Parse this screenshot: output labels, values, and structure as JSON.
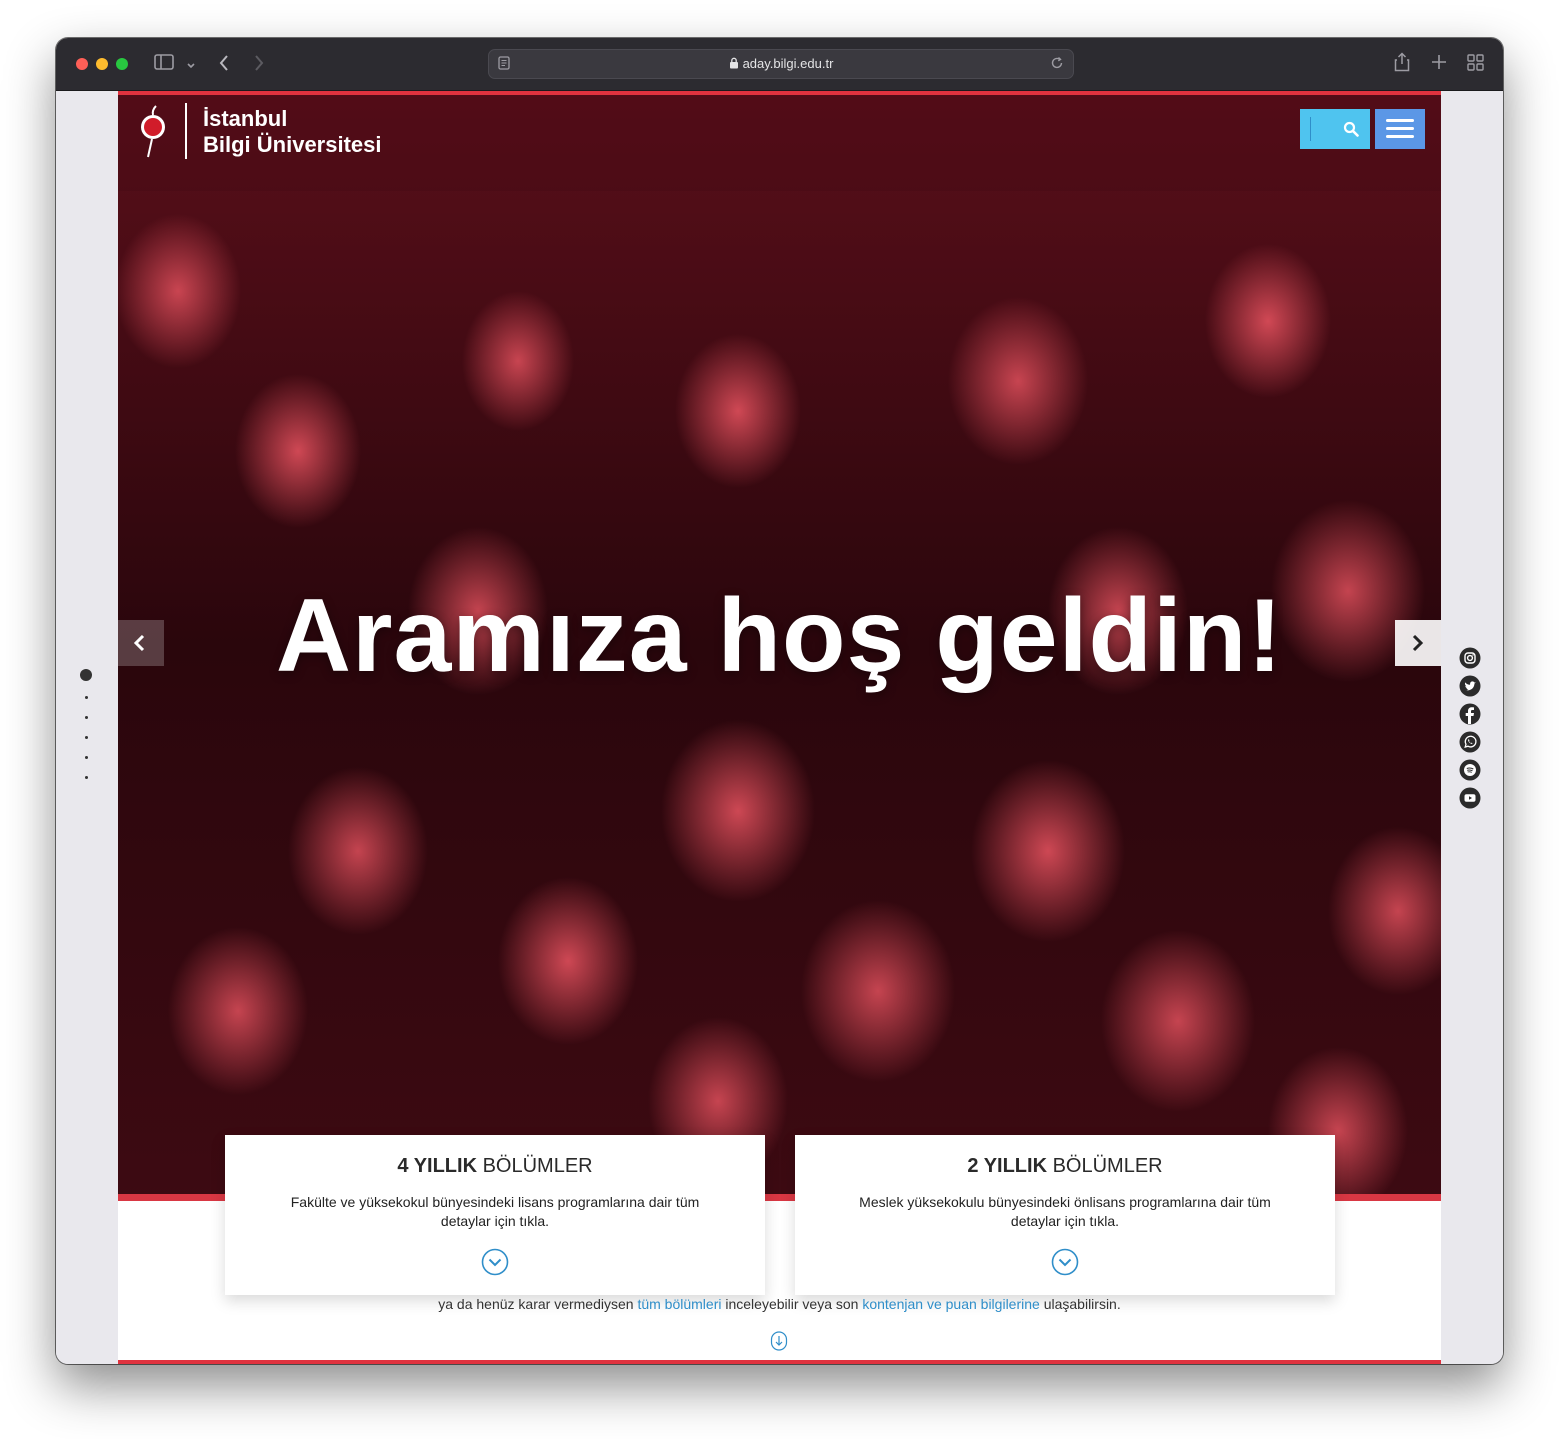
{
  "browser": {
    "url": "aday.bilgi.edu.tr"
  },
  "header": {
    "logo_line1": "İstanbul",
    "logo_line2": "Bilgi Üniversitesi"
  },
  "hero": {
    "title": "Aramıza hoş geldin!"
  },
  "cards": [
    {
      "title_bold": "4 YILLIK",
      "title_rest": " BÖLÜMLER",
      "description": "Fakülte ve yüksekokul bünyesindeki lisans programlarına dair tüm detaylar için tıkla."
    },
    {
      "title_bold": "2 YILLIK",
      "title_rest": " BÖLÜMLER",
      "description": "Meslek yüksekokulu bünyesindeki önlisans programlarına dair tüm detaylar için tıkla."
    }
  ],
  "bottom": {
    "text_1": "ya da henüz karar vermediysen ",
    "link_1": "tüm bölümleri",
    "text_2": " inceleyebilir veya son ",
    "link_2": "kontenjan ve puan bilgilerine",
    "text_3": " ulaşabilirsin."
  },
  "social_icons": [
    "instagram-icon",
    "twitter-icon",
    "facebook-icon",
    "whatsapp-icon",
    "spotify-icon",
    "youtube-icon"
  ],
  "colors": {
    "brand_red": "#e0333f",
    "search_blue": "#4fc4ef",
    "menu_blue": "#5b97e6",
    "link_blue": "#2f8ec9"
  }
}
